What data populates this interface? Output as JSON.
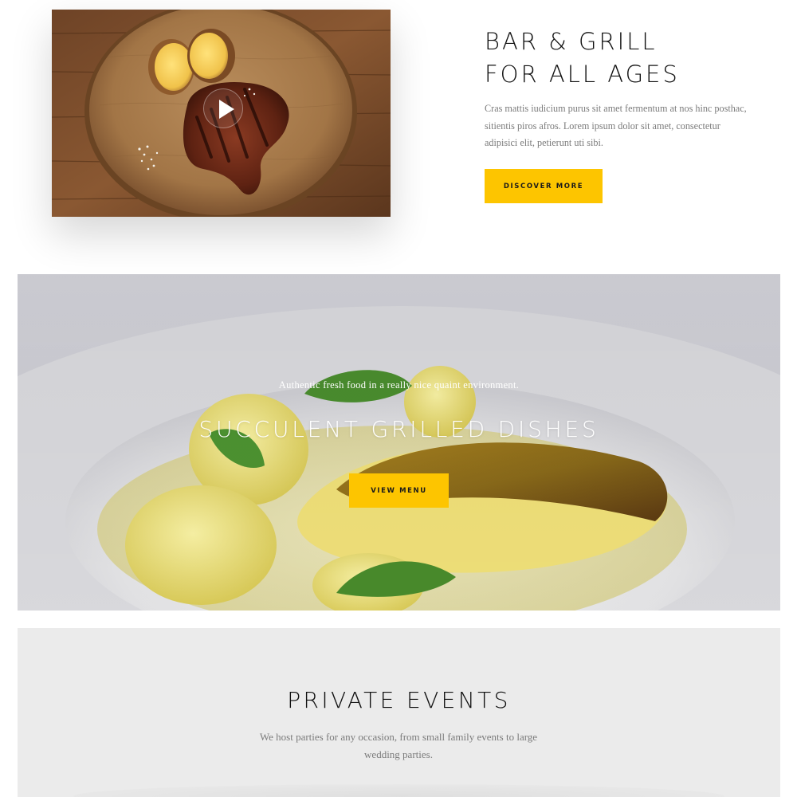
{
  "intro": {
    "title_line1": "BAR & GRILL",
    "title_line2": "FOR ALL AGES",
    "paragraph": "Cras mattis iudicium purus sit amet fermentum at nos hinc posthac, sitientis piros afros. Lorem ipsum dolor sit amet, consectetur adipisici elit, petierunt uti sibi.",
    "button_label": "DISCOVER MORE",
    "media_icon": "play-icon"
  },
  "hero": {
    "subtitle": "Authentic fresh food in a really nice quaint environment.",
    "title": "SUCCULENT GRILLED DISHES",
    "button_label": "VIEW MENU"
  },
  "events": {
    "title": "PRIVATE EVENTS",
    "paragraph": "We host parties for any occasion, from small family events to large wedding parties."
  },
  "colors": {
    "accent": "#fdc500",
    "heading": "#111111",
    "body_text": "#7b7b7b",
    "section_bg": "#ebebeb"
  }
}
